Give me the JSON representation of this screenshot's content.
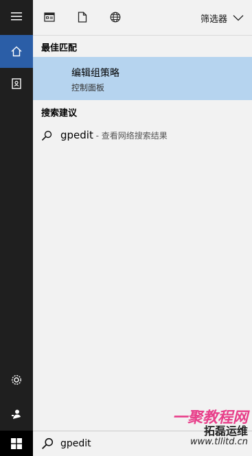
{
  "rail": {
    "items": [
      {
        "icon": "hamburger-menu-icon"
      },
      {
        "icon": "home-icon",
        "active": true
      },
      {
        "icon": "notebook-icon"
      },
      {
        "icon": "settings-gear-icon"
      },
      {
        "icon": "feedback-person-icon"
      }
    ]
  },
  "topbar": {
    "filter_label": "筛选器",
    "icons": [
      "apps-icon",
      "documents-icon",
      "web-globe-icon",
      "chevron-down-icon"
    ]
  },
  "best_match": {
    "section_title": "最佳匹配",
    "title": "编辑组策略",
    "subtitle": "控制面板"
  },
  "search_suggestions": {
    "section_title": "搜索建议",
    "items": [
      {
        "query": "gpedit",
        "hint": " - 查看网络搜索结果"
      }
    ]
  },
  "taskbar": {
    "search_value": "gpedit"
  },
  "watermark": {
    "line1": "一聚教程网",
    "line2": "拓磊运维",
    "line3": "www.tllitd.cn"
  },
  "colors": {
    "rail_bg": "#1f1f1f",
    "rail_active": "#2b5ea7",
    "panel_bg": "#f2f2f2",
    "highlight": "#b6d4ef",
    "watermark_pink": "#e83f8a"
  }
}
